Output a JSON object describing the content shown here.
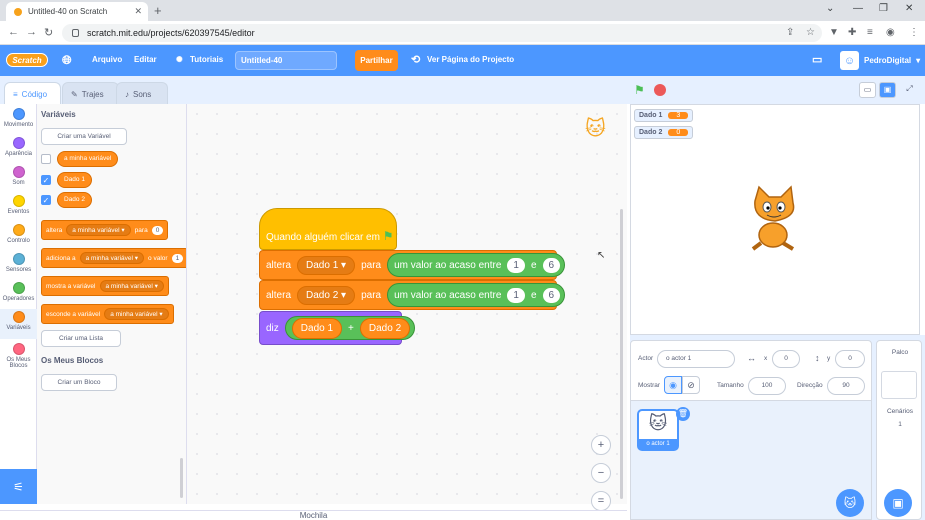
{
  "browser": {
    "tab_title": "Untitled-40 on Scratch",
    "url": "scratch.mit.edu/projects/620397545/editor"
  },
  "menu": {
    "logo": "Scratch",
    "file": "Arquivo",
    "edit": "Editar",
    "tutorials": "Tutoriais",
    "project_title": "Untitled-40",
    "share": "Partilhar",
    "see_project": "Ver Página do Projecto",
    "username": "PedroDigital"
  },
  "editor_tabs": [
    "Código",
    "Trajes",
    "Sons"
  ],
  "categories": [
    {
      "label": "Movimento",
      "color": "#4c97ff"
    },
    {
      "label": "Aparência",
      "color": "#9966ff"
    },
    {
      "label": "Som",
      "color": "#cf63cf"
    },
    {
      "label": "Eventos",
      "color": "#ffd500"
    },
    {
      "label": "Controlo",
      "color": "#ffab19"
    },
    {
      "label": "Sensores",
      "color": "#5cb1d6"
    },
    {
      "label": "Operadores",
      "color": "#59c059"
    },
    {
      "label": "Variáveis",
      "color": "#ff8c1a"
    },
    {
      "label": "Os Meus Blocos",
      "color": "#ff6680"
    }
  ],
  "palette": {
    "heading_vars": "Variáveis",
    "make_var": "Criar uma Variável",
    "vars": [
      "a minha variável",
      "Dado 1",
      "Dado 2"
    ],
    "set_block": {
      "text": "altera",
      "var": "a minha variável",
      "to": "para",
      "value": "0"
    },
    "change_block": {
      "text": "adiciona a",
      "var": "a minha variável",
      "to": "o valor",
      "value": "1"
    },
    "show_block": {
      "text": "mostra a variável",
      "var": "a minha variável"
    },
    "hide_block": {
      "text": "esconde a variável",
      "var": "a minha variável"
    },
    "make_list": "Criar uma Lista",
    "heading_my_blocks": "Os Meus Blocos",
    "make_block": "Criar um Bloco"
  },
  "script": {
    "hat": "Quando alguém clicar em",
    "set1": {
      "verb": "altera",
      "var": "Dado 1",
      "to": "para",
      "op": "um valor ao acaso entre",
      "a": "1",
      "and": "e",
      "b": "6"
    },
    "set2": {
      "verb": "altera",
      "var": "Dado 2",
      "to": "para",
      "op": "um valor ao acaso entre",
      "a": "1",
      "and": "e",
      "b": "6"
    },
    "say": {
      "verb": "diz",
      "left": "Dado 1",
      "plus": "+",
      "right": "Dado 2"
    }
  },
  "monitors": [
    {
      "label": "Dado 1",
      "value": "3"
    },
    {
      "label": "Dado 2",
      "value": "0"
    }
  ],
  "sprite_info": {
    "sprite_label": "Actor",
    "sprite_name": "o actor 1",
    "x_label": "x",
    "x": "0",
    "y_label": "y",
    "y": "0",
    "show_label": "Mostrar",
    "size_label": "Tamanho",
    "size": "100",
    "direction_label": "Direcção",
    "direction": "90"
  },
  "stage_panel": {
    "title": "Palco",
    "backdrops_label": "Cenários",
    "backdrops_count": "1"
  },
  "backpack": "Mochila"
}
